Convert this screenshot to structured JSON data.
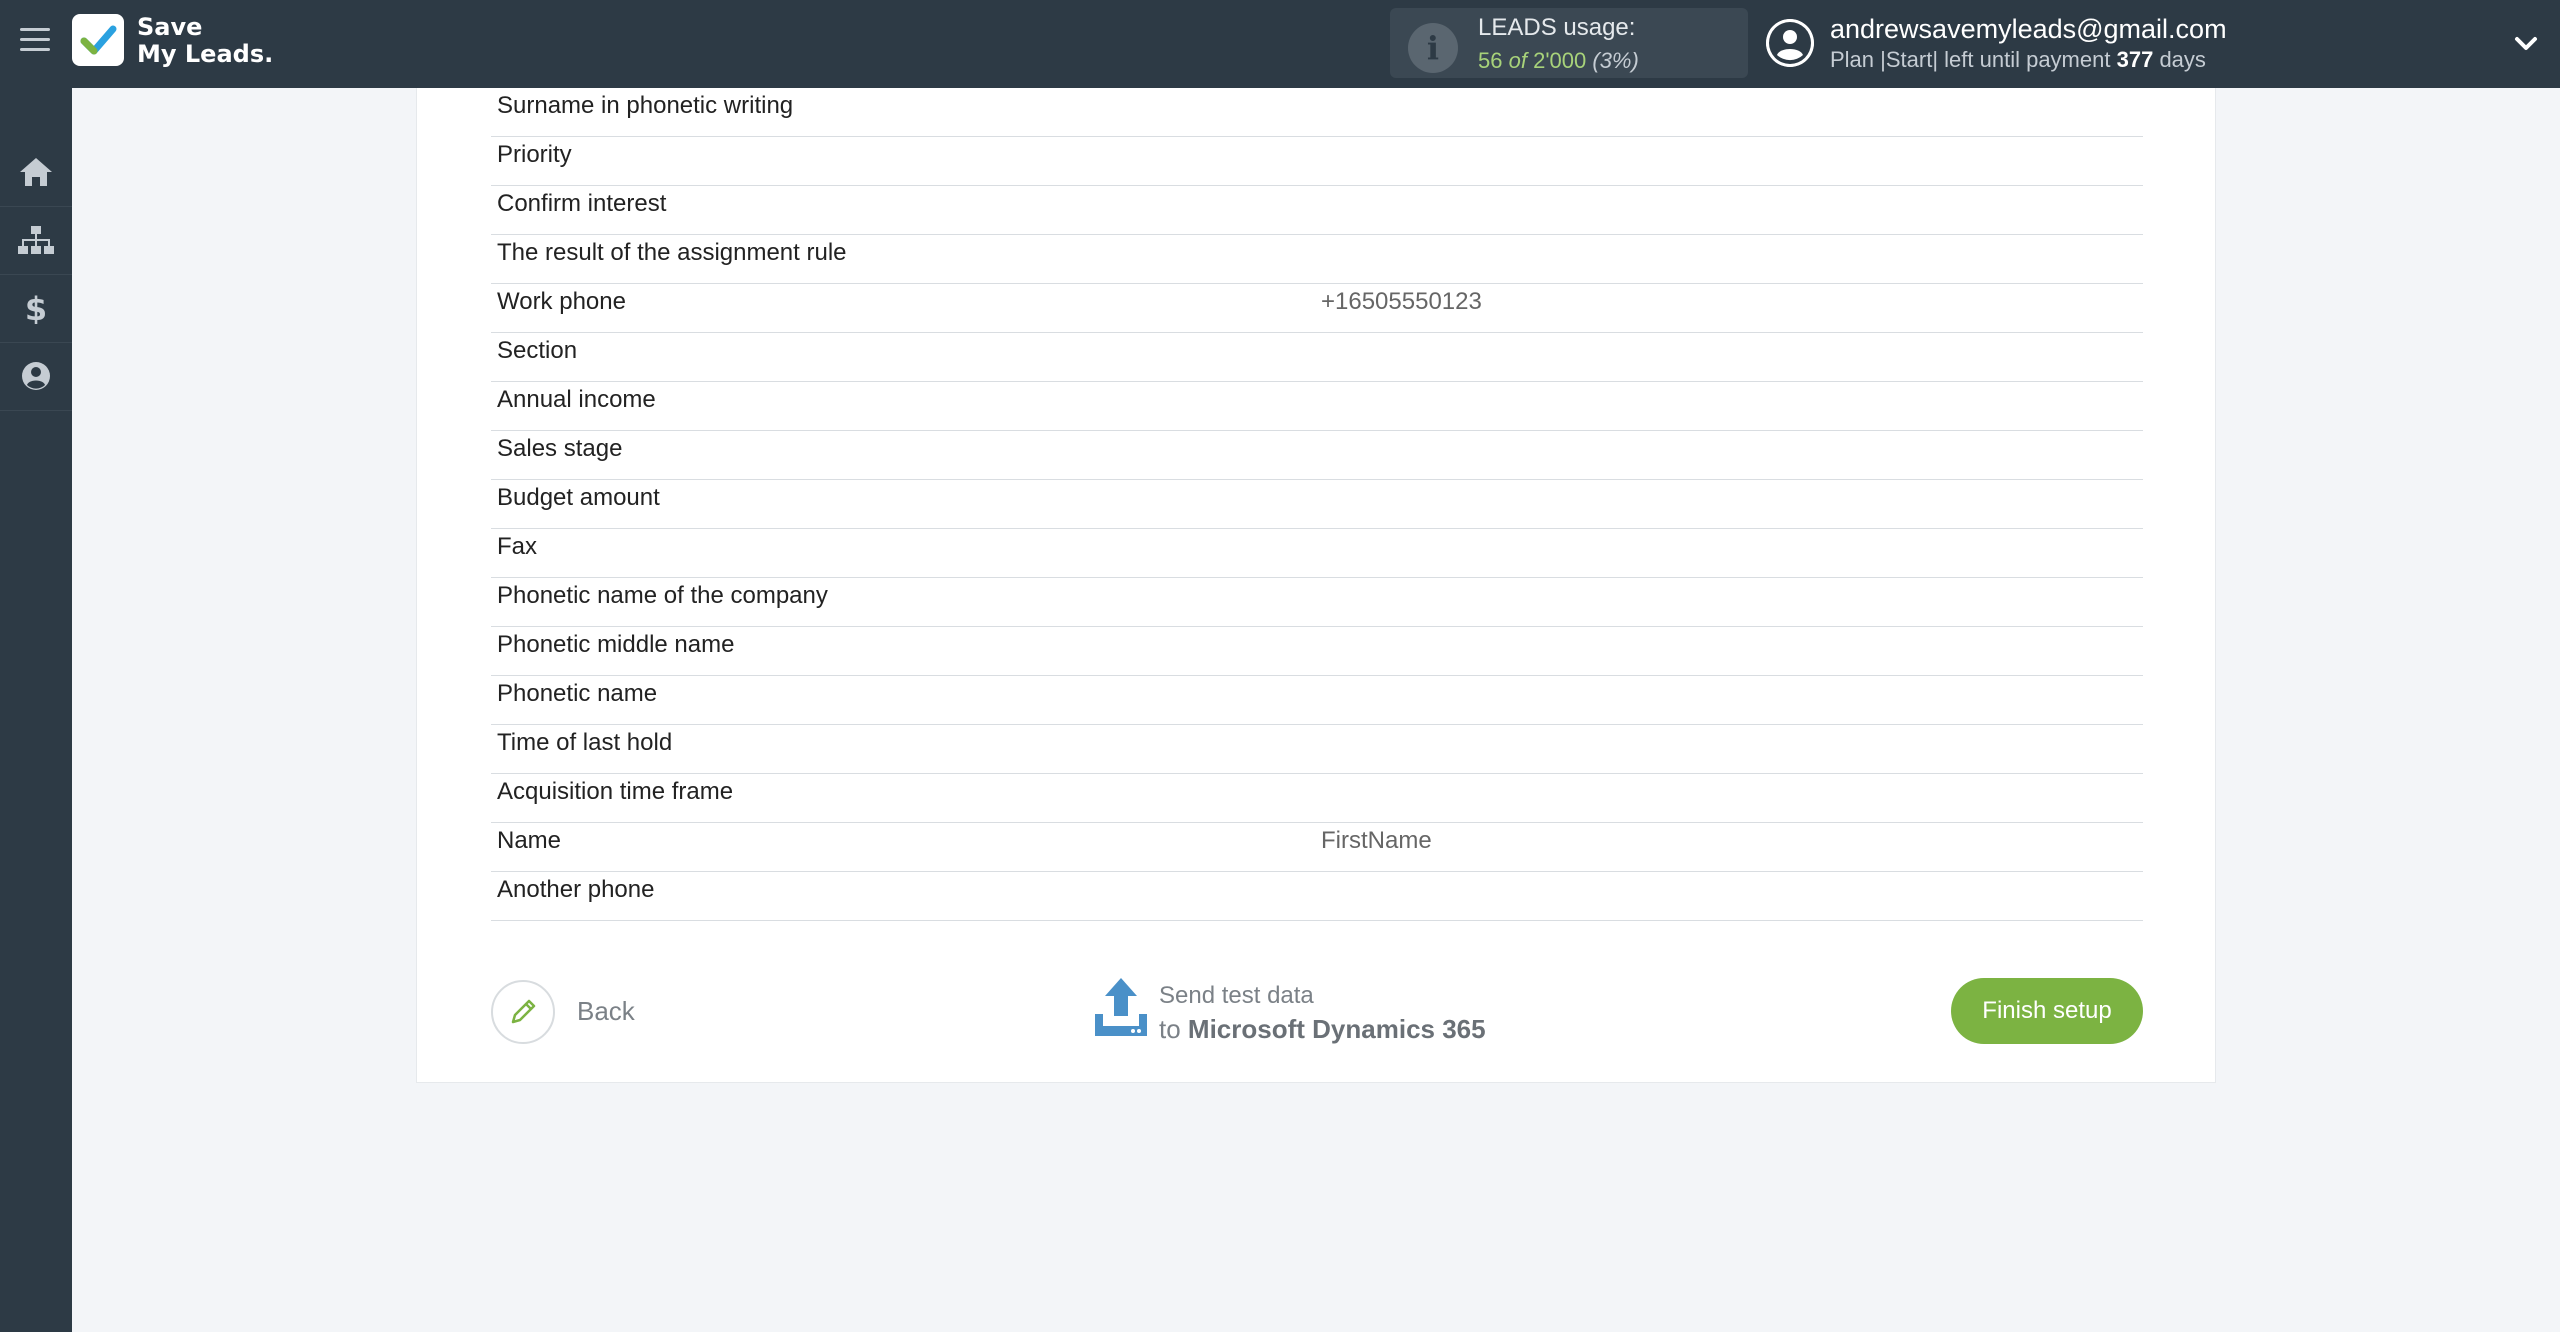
{
  "header": {
    "logo_line1": "Save",
    "logo_line2": "My Leads.",
    "usage_title": "LEADS usage:",
    "usage_used": "56",
    "usage_of": "of",
    "usage_total": "2'000",
    "usage_percent": "(3%)",
    "user_email": "andrewsavemyleads@gmail.com",
    "plan_text": "Plan |Start| left until payment",
    "days_left": "377",
    "days_label": "days"
  },
  "sidebar": {
    "items": [
      {
        "icon": "home-icon"
      },
      {
        "icon": "sitemap-icon"
      },
      {
        "icon": "dollar-icon"
      },
      {
        "icon": "user-circle-icon"
      }
    ]
  },
  "fields": [
    {
      "label": "Surname in phonetic writing",
      "value": ""
    },
    {
      "label": "Priority",
      "value": ""
    },
    {
      "label": "Confirm interest",
      "value": ""
    },
    {
      "label": "The result of the assignment rule",
      "value": ""
    },
    {
      "label": "Work phone",
      "value": "+16505550123"
    },
    {
      "label": "Section",
      "value": ""
    },
    {
      "label": "Annual income",
      "value": ""
    },
    {
      "label": "Sales stage",
      "value": ""
    },
    {
      "label": "Budget amount",
      "value": ""
    },
    {
      "label": "Fax",
      "value": ""
    },
    {
      "label": "Phonetic name of the company",
      "value": ""
    },
    {
      "label": "Phonetic middle name",
      "value": ""
    },
    {
      "label": "Phonetic name",
      "value": ""
    },
    {
      "label": "Time of last hold",
      "value": ""
    },
    {
      "label": "Acquisition time frame",
      "value": ""
    },
    {
      "label": "Name",
      "value": "FirstName"
    },
    {
      "label": "Another phone",
      "value": ""
    }
  ],
  "footer": {
    "back_label": "Back",
    "send_line1": "Send test data",
    "send_to": "to",
    "send_target": "Microsoft Dynamics 365",
    "finish_label": "Finish setup"
  },
  "colors": {
    "topbar": "#2d3a45",
    "accent_green": "#7cb342",
    "upload_blue": "#4a90c8"
  }
}
